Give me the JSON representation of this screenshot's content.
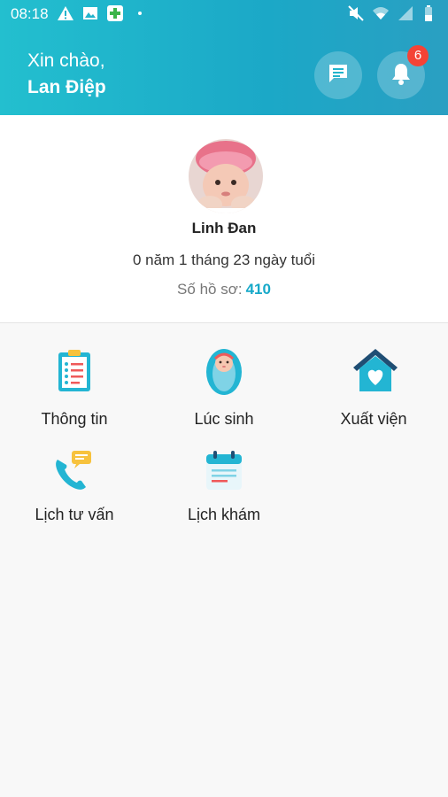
{
  "status_bar": {
    "time": "08:18",
    "left_icons": [
      "warning-icon",
      "image-icon",
      "medical-plus-icon",
      "dot-icon"
    ],
    "right_icons": [
      "mute-icon",
      "wifi-icon",
      "signal-icon",
      "battery-icon"
    ]
  },
  "header": {
    "greeting": "Xin chào,",
    "user_name": "Lan Điệp",
    "chat_icon": "chat-icon",
    "bell_icon": "bell-icon",
    "notification_count": "6",
    "colors": {
      "start": "#23bfcf",
      "end": "#2a9fc2"
    }
  },
  "profile": {
    "name": "Linh Đan",
    "age": "0 năm 1 tháng 23 ngày tuổi",
    "record_label": "Số hồ sơ:",
    "record_number": "410"
  },
  "menu": [
    {
      "label": "Thông tin",
      "icon": "clipboard-icon"
    },
    {
      "label": "Lúc sinh",
      "icon": "swaddled-baby-icon"
    },
    {
      "label": "Xuất viện",
      "icon": "home-heart-icon"
    },
    {
      "label": "Lịch tư vấn",
      "icon": "phone-chat-icon"
    },
    {
      "label": "Lịch khám",
      "icon": "calendar-icon"
    }
  ],
  "colors": {
    "accent": "#17a9c9",
    "badge": "#f44336"
  }
}
